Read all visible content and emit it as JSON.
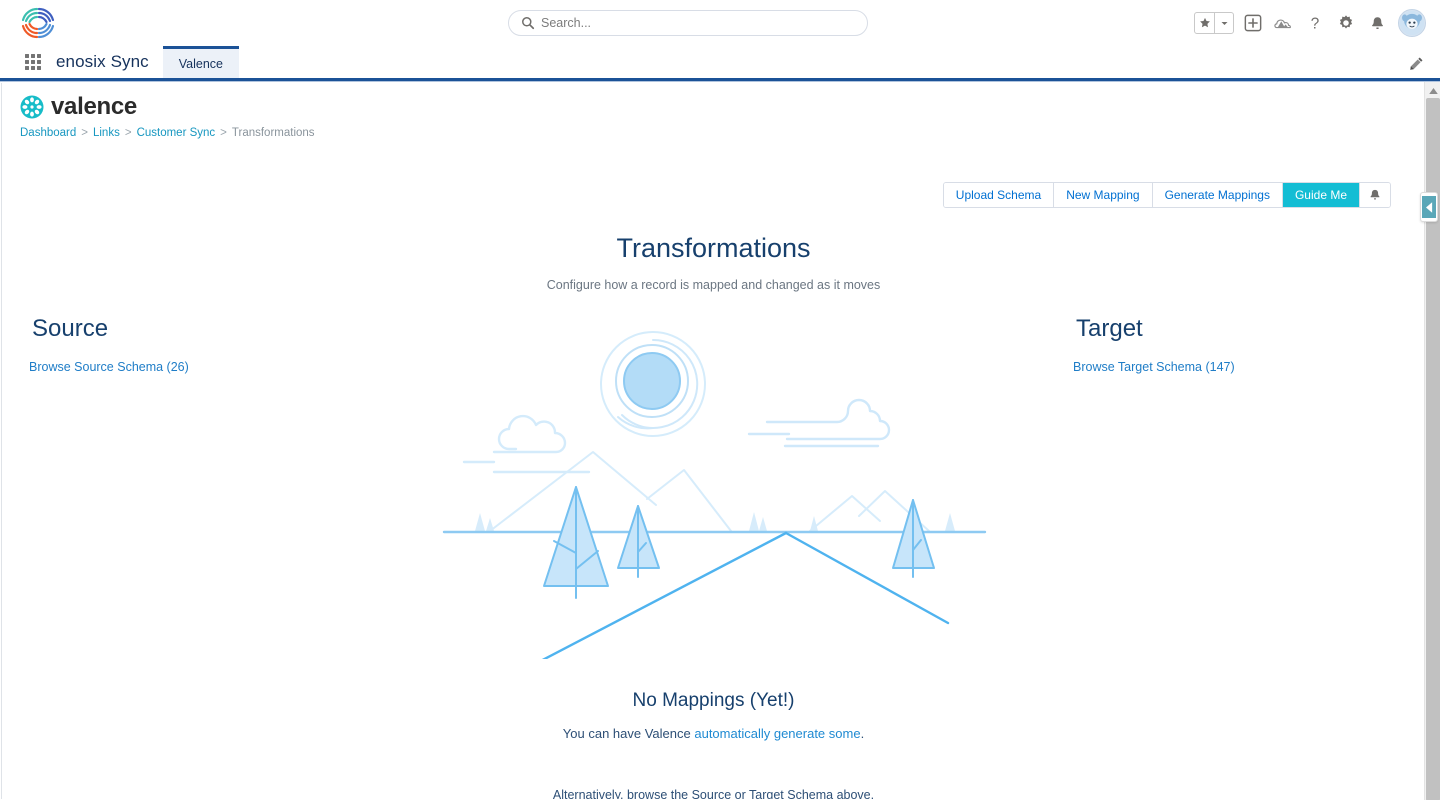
{
  "global_header": {
    "logo_icon": "enosix-pinwheel-logo",
    "search": {
      "placeholder": "Search...",
      "value": "",
      "icon": "search-icon"
    },
    "actions": [
      {
        "name": "favorites-star",
        "icon": "star-icon"
      },
      {
        "name": "favorites-dropdown",
        "icon": "chevron-down-icon"
      },
      {
        "name": "global-create",
        "icon": "plus-icon"
      },
      {
        "name": "mobile-publisher",
        "icon": "cloud-mountain-icon"
      },
      {
        "name": "help",
        "icon": "question-mark-icon"
      },
      {
        "name": "setup",
        "icon": "gear-icon"
      },
      {
        "name": "notifications",
        "icon": "bell-icon"
      },
      {
        "name": "user-avatar",
        "icon": "avatar-icon"
      }
    ]
  },
  "app_nav": {
    "app_launcher_icon": "waffle-grid-icon",
    "app_name": "enosix Sync",
    "tabs": [
      {
        "label": "Valence",
        "active": true
      }
    ],
    "edit_icon": "pencil-icon"
  },
  "valence": {
    "brand": {
      "name": "valence",
      "mark_icon": "valence-flower-icon"
    },
    "breadcrumb": {
      "items": [
        {
          "label": "Dashboard",
          "link": true
        },
        {
          "label": "Links",
          "link": true
        },
        {
          "label": "Customer Sync",
          "link": true
        },
        {
          "label": "Transformations",
          "link": false
        }
      ],
      "separator": ">"
    },
    "actions": [
      {
        "label": "Upload Schema",
        "style": "secondary"
      },
      {
        "label": "New Mapping",
        "style": "secondary"
      },
      {
        "label": "Generate Mappings",
        "style": "secondary"
      },
      {
        "label": "Guide Me",
        "style": "primary"
      }
    ],
    "actions_bell_icon": "bell-icon",
    "page": {
      "title": "Transformations",
      "subtitle": "Configure how a record is mapped and changed as it moves"
    },
    "source": {
      "heading": "Source",
      "browse_link": "Browse Source Schema (26)",
      "schema_count": 26
    },
    "target": {
      "heading": "Target",
      "browse_link": "Browse Target Schema (147)",
      "schema_count": 147
    },
    "illustration": {
      "name": "desert-landscape-illustration"
    },
    "empty_state": {
      "title": "No Mappings (Yet!)",
      "description_prefix": "You can have Valence ",
      "description_link": "automatically generate some",
      "description_suffix": ".",
      "alternative": "Alternatively, browse the Source or Target Schema above."
    }
  },
  "scrollbar": {
    "up_arrow_icon": "caret-up-icon",
    "panel_toggle_icon": "caret-left-icon"
  },
  "colors": {
    "accent_teal": "#14bdd4",
    "link_blue": "#0070d2",
    "breadcrumb_blue": "#1797c0",
    "title_navy": "#17406d",
    "nav_border": "#1b5297",
    "illustration_blue": "#7fc9f2"
  }
}
